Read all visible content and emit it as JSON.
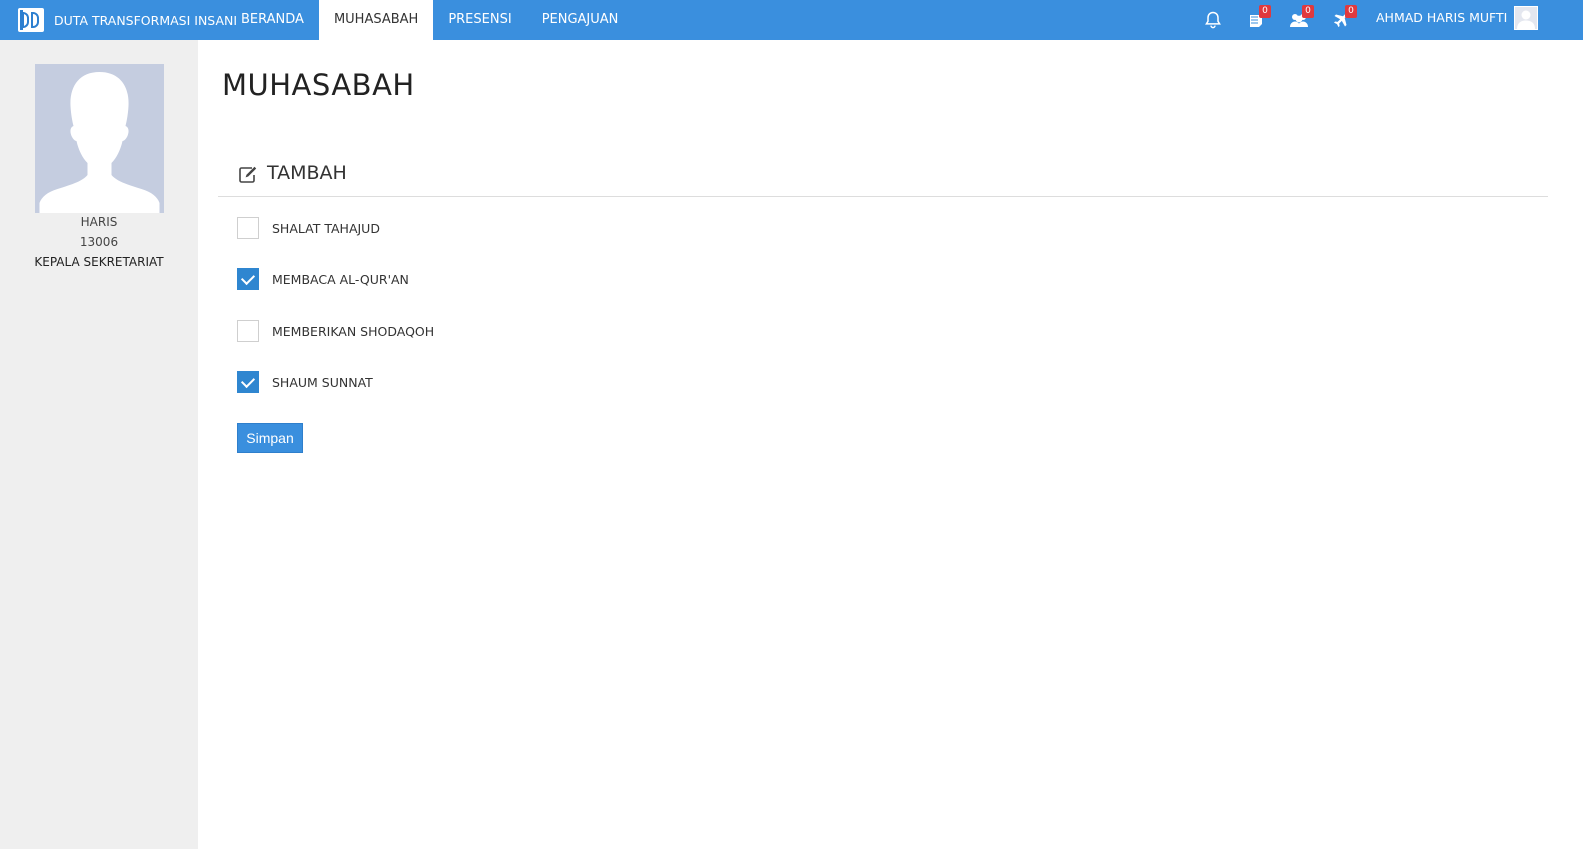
{
  "header": {
    "brand_name": "DUTA TRANSFORMASI INSANI",
    "nav": [
      {
        "label": "BERANDA",
        "active": false
      },
      {
        "label": "MUHASABAH",
        "active": true
      },
      {
        "label": "PRESENSI",
        "active": false
      },
      {
        "label": "PENGAJUAN",
        "active": false
      }
    ],
    "notifications": {
      "icon": "bell-icon",
      "books_count": "0",
      "users_count": "0",
      "plane_count": "0"
    },
    "user_name": "AHMAD HARIS MUFTI"
  },
  "sidebar": {
    "name": "HARIS",
    "id_number": "13006",
    "role": "KEPALA SEKRETARIAT"
  },
  "page": {
    "title": "MUHASABAH",
    "section_title": "TAMBAH",
    "items": [
      {
        "label": "SHALAT TAHAJUD",
        "checked": false
      },
      {
        "label": "MEMBACA AL-QUR'AN",
        "checked": true
      },
      {
        "label": "MEMBERIKAN SHODAQOH",
        "checked": false
      },
      {
        "label": "SHAUM SUNNAT",
        "checked": true
      }
    ],
    "save_label": "Simpan"
  },
  "colors": {
    "topbar": "#3a8fde",
    "sidebar": "#efefef",
    "checkbox_checked": "#2f86d0",
    "badge": "#e0393e"
  }
}
